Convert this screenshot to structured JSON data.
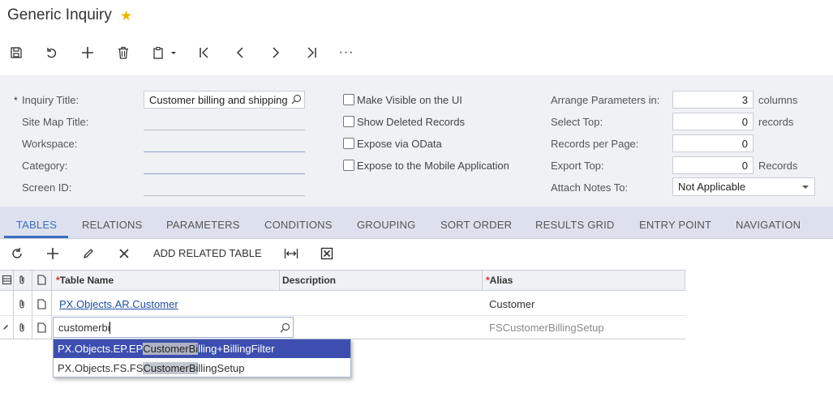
{
  "page": {
    "title": "Generic Inquiry",
    "star_icon": "star-icon"
  },
  "toolbar": {
    "save": "save-icon",
    "undo": "undo-icon",
    "add": "plus-icon",
    "delete": "trash-icon",
    "copy": "clipboard-icon",
    "first": "first-icon",
    "prev": "prev-icon",
    "next": "next-icon",
    "last": "last-icon",
    "more": "···"
  },
  "form": {
    "inquiry_title_label": "Inquiry Title:",
    "inquiry_title_value": "Customer billing and shipping",
    "site_map_title_label": "Site Map Title:",
    "workspace_label": "Workspace:",
    "category_label": "Category:",
    "screen_id_label": "Screen ID:",
    "required_mark": "*",
    "make_visible_label": "Make Visible on the UI",
    "show_deleted_label": "Show Deleted Records",
    "expose_odata_label": "Expose via OData",
    "expose_mobile_label": "Expose to the Mobile Application",
    "arrange_label": "Arrange Parameters in:",
    "arrange_value": "3",
    "arrange_unit": "columns",
    "select_top_label": "Select Top:",
    "select_top_value": "0",
    "select_top_unit": "records",
    "records_per_page_label": "Records per Page:",
    "records_per_page_value": "0",
    "export_top_label": "Export Top:",
    "export_top_value": "0",
    "export_top_unit": "Records",
    "attach_notes_label": "Attach Notes To:",
    "attach_notes_value": "Not Applicable"
  },
  "tabs": [
    "TABLES",
    "RELATIONS",
    "PARAMETERS",
    "CONDITIONS",
    "GROUPING",
    "SORT ORDER",
    "RESULTS GRID",
    "ENTRY POINT",
    "NAVIGATION"
  ],
  "grid_toolbar": {
    "add_related_table": "ADD RELATED TABLE"
  },
  "grid": {
    "headers": {
      "table_name": "Table Name",
      "description": "Description",
      "alias": "Alias",
      "required_mark": "*"
    },
    "rows": [
      {
        "table_name": "PX.Objects.AR.Customer",
        "description": "",
        "alias": "Customer"
      },
      {
        "table_name": "customerbi",
        "description": "",
        "alias": "FSCustomerBillingSetup"
      }
    ]
  },
  "autocomplete": [
    {
      "prefix": "PX.Objects.EP.EP",
      "match": "CustomerBi",
      "suffix": "lling+BillingFilter",
      "selected": true
    },
    {
      "prefix": "PX.Objects.FS.FS",
      "match": "CustomerBi",
      "suffix": "llingSetup",
      "selected": false
    }
  ]
}
